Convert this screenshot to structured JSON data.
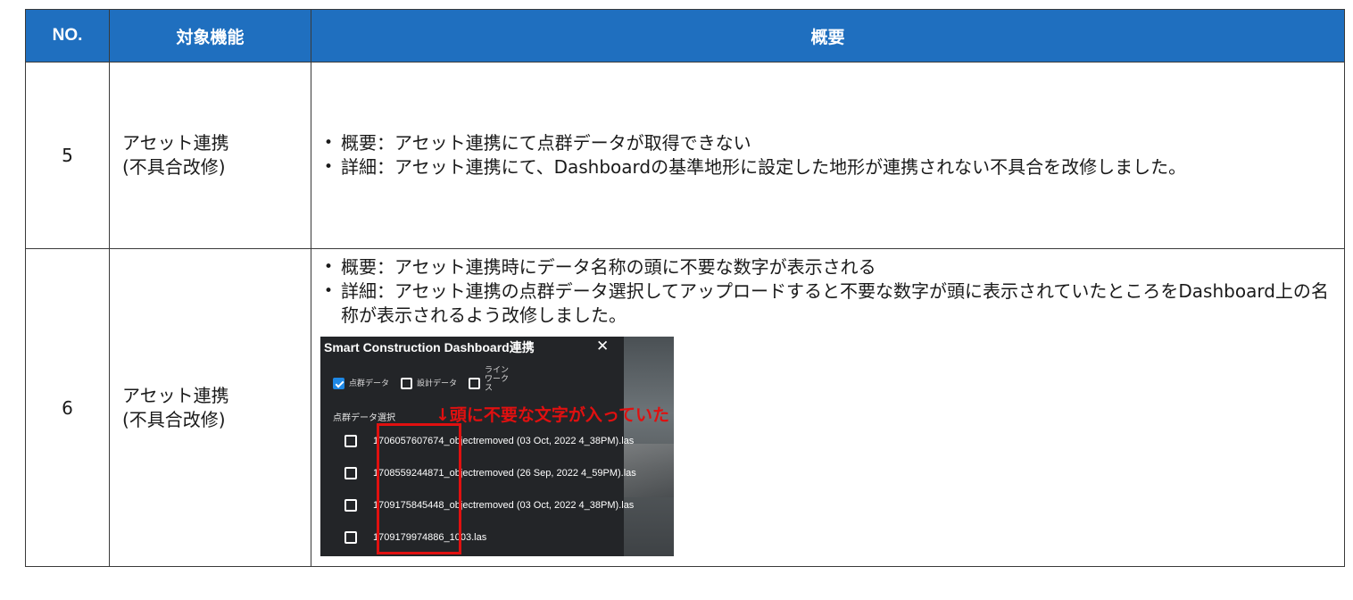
{
  "table": {
    "headers": {
      "no": "NO.",
      "feature": "対象機能",
      "summary": "概要"
    },
    "rows": [
      {
        "no": "5",
        "feature_line1": "アセット連携",
        "feature_line2": "(不具合改修)",
        "bullets": [
          "概要：アセット連携にて点群データが取得できない",
          "詳細：アセット連携にて、Dashboardの基準地形に設定した地形が連携されない不具合を改修しました。"
        ]
      },
      {
        "no": "6",
        "feature_line1": "アセット連携",
        "feature_line2": "(不具合改修)",
        "bullets": [
          "概要：アセット連携時にデータ名称の頭に不要な数字が表示される",
          "詳細：アセット連携の点群データ選択してアップロードすると不要な数字が頭に表示されていたところをDashboard上の名称が表示されるよう改修しました。"
        ]
      }
    ]
  },
  "screenshot": {
    "dialog_title": "Smart Construction Dashboard連携",
    "close_glyph": "✕",
    "filters": [
      {
        "label": "点群データ",
        "checked": true
      },
      {
        "label": "設計データ",
        "checked": false
      },
      {
        "label": "ラインワークス",
        "checked": false
      }
    ],
    "section_label": "点群データ選択",
    "files": [
      "1706057607674_objectremoved (03 Oct, 2022 4_38PM).las",
      "1708559244871_objectremoved (26 Sep, 2022 4_59PM).las",
      "1709175845448_objectremoved (03 Oct, 2022 4_38PM).las",
      "1709179974886_1003.las"
    ],
    "highlight_color": "#e01010",
    "accent_color": "#1e88e5"
  },
  "annotation": "↓頭に不要な文字が入っていた",
  "colors": {
    "header_bg": "#1f6fbf",
    "header_text": "#ffffff"
  }
}
